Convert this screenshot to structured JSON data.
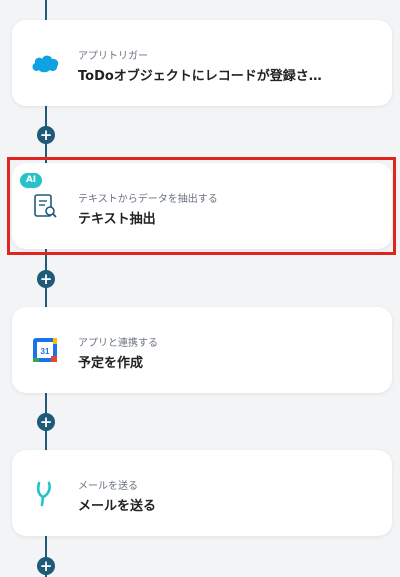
{
  "steps": [
    {
      "subtitle": "アプリトリガー",
      "title": "ToDoオブジェクトにレコードが登録さ…",
      "icon": "salesforce-cloud-icon"
    },
    {
      "badge": "AI",
      "subtitle": "テキストからデータを抽出する",
      "title": "テキスト抽出",
      "icon": "document-search-icon"
    },
    {
      "subtitle": "アプリと連携する",
      "title": "予定を作成",
      "icon": "google-calendar-icon",
      "calendar_day": "31"
    },
    {
      "subtitle": "メールを送る",
      "title": "メールを送る",
      "icon": "mail-y-icon"
    }
  ],
  "add_step_label": "+",
  "colors": {
    "connector": "#1f5a78",
    "highlight": "#e0241f",
    "ai_badge": "#25c3c9"
  }
}
